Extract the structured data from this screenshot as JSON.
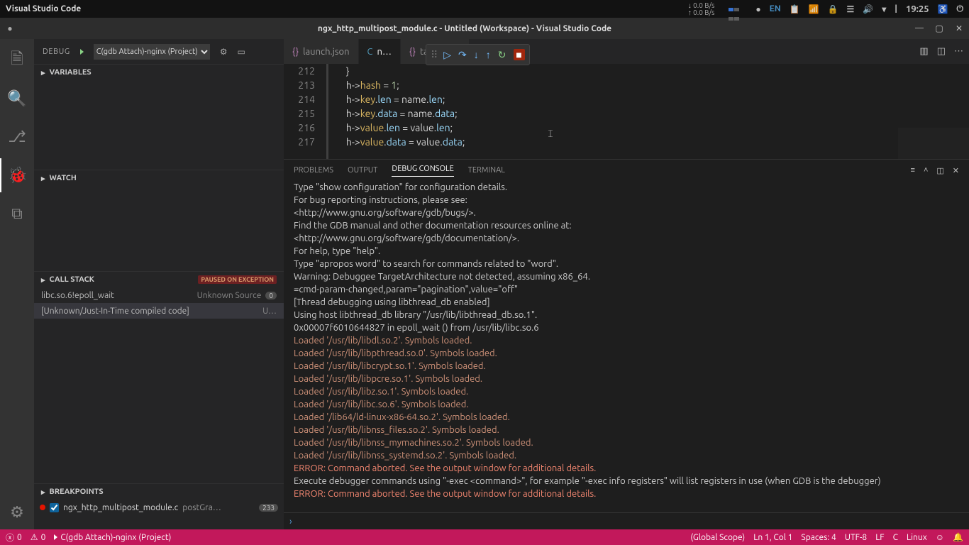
{
  "gnome": {
    "app": "Visual Studio Code",
    "netDown": "0.0 B/s",
    "netUp": "0.0 B/s",
    "lang": "EN",
    "time": "19:25"
  },
  "titlebar": {
    "dirty": "●",
    "title": "ngx_http_multipost_module.c - Untitled (Workspace) - Visual Studio Code"
  },
  "sideHeader": {
    "label": "DEBUG",
    "config": "C(gdb Attach)-nginx (Project)"
  },
  "sections": {
    "variables": "VARIABLES",
    "watch": "WATCH",
    "callstack": "CALL STACK",
    "callstackBadge": "PAUSED ON EXCEPTION",
    "breakpoints": "BREAKPOINTS"
  },
  "callstack": [
    {
      "fn": "libc.so.6!epoll_wait",
      "src": "Unknown Source",
      "n": "0"
    },
    {
      "fn": "[Unknown/Just-In-Time compiled code]",
      "src": "U…",
      "n": ""
    }
  ],
  "breakpoints": [
    {
      "file": "ngx_http_multipost_module.c",
      "cond": "postGra…",
      "line": "233"
    }
  ],
  "tabs": [
    {
      "icon": "{}",
      "label": "launch.json",
      "active": false,
      "iconClass": "tabico"
    },
    {
      "icon": "C",
      "label": "n…",
      "active": true,
      "iconClass": "tabico c"
    },
    {
      "icon": "{}",
      "label": "tasks.json",
      "active": false,
      "iconClass": "tabico"
    }
  ],
  "code": {
    "start": 212,
    "lines": [
      "    }",
      "    h->hash = 1;",
      "    h->key.len = name.len;",
      "    h->key.data = name.data;",
      "    h->value.len = value.len;",
      "    h->value.data = value.data;"
    ]
  },
  "panelTabs": {
    "problems": "PROBLEMS",
    "output": "OUTPUT",
    "debug": "DEBUG CONSOLE",
    "terminal": "TERMINAL"
  },
  "console": [
    {
      "c": "",
      "t": "Type \"show configuration\" for configuration details."
    },
    {
      "c": "",
      "t": "For bug reporting instructions, please see:"
    },
    {
      "c": "",
      "t": "<http://www.gnu.org/software/gdb/bugs/>."
    },
    {
      "c": "",
      "t": "Find the GDB manual and other documentation resources online at:"
    },
    {
      "c": "",
      "t": "<http://www.gnu.org/software/gdb/documentation/>."
    },
    {
      "c": "",
      "t": "For help, type \"help\"."
    },
    {
      "c": "",
      "t": "Type \"apropos word\" to search for commands related to \"word\"."
    },
    {
      "c": "",
      "t": "Warning: Debuggee TargetArchitecture not detected, assuming x86_64."
    },
    {
      "c": "",
      "t": "=cmd-param-changed,param=\"pagination\",value=\"off\""
    },
    {
      "c": "",
      "t": "[Thread debugging using libthread_db enabled]"
    },
    {
      "c": "",
      "t": "Using host libthread_db library \"/usr/lib/libthread_db.so.1\"."
    },
    {
      "c": "",
      "t": "0x00007f6010644827 in epoll_wait () from /usr/lib/libc.so.6"
    },
    {
      "c": "loaded",
      "t": "Loaded '/usr/lib/libdl.so.2'. Symbols loaded."
    },
    {
      "c": "loaded",
      "t": "Loaded '/usr/lib/libpthread.so.0'. Symbols loaded."
    },
    {
      "c": "loaded",
      "t": "Loaded '/usr/lib/libcrypt.so.1'. Symbols loaded."
    },
    {
      "c": "loaded",
      "t": "Loaded '/usr/lib/libpcre.so.1'. Symbols loaded."
    },
    {
      "c": "loaded",
      "t": "Loaded '/usr/lib/libz.so.1'. Symbols loaded."
    },
    {
      "c": "loaded",
      "t": "Loaded '/usr/lib/libc.so.6'. Symbols loaded."
    },
    {
      "c": "loaded",
      "t": "Loaded '/lib64/ld-linux-x86-64.so.2'. Symbols loaded."
    },
    {
      "c": "loaded",
      "t": "Loaded '/usr/lib/libnss_files.so.2'. Symbols loaded."
    },
    {
      "c": "loaded",
      "t": "Loaded '/usr/lib/libnss_mymachines.so.2'. Symbols loaded."
    },
    {
      "c": "loaded",
      "t": "Loaded '/usr/lib/libnss_systemd.so.2'. Symbols loaded."
    },
    {
      "c": "err",
      "t": "ERROR: Command aborted. See the output window for additional details."
    },
    {
      "c": "",
      "t": "Execute debugger commands using \"-exec <command>\", for example \"-exec info registers\" will list registers in use (when GDB is the debugger)"
    },
    {
      "c": "err",
      "t": "ERROR: Command aborted. See the output window for additional details."
    }
  ],
  "status": {
    "errors": "0",
    "warnings": "0",
    "debug": "C(gdb Attach)-nginx (Project)",
    "scope": "(Global Scope)",
    "pos": "Ln 1, Col 1",
    "spaces": "Spaces: 4",
    "enc": "UTF-8",
    "eol": "LF",
    "lang": "C",
    "os": "Linux"
  }
}
